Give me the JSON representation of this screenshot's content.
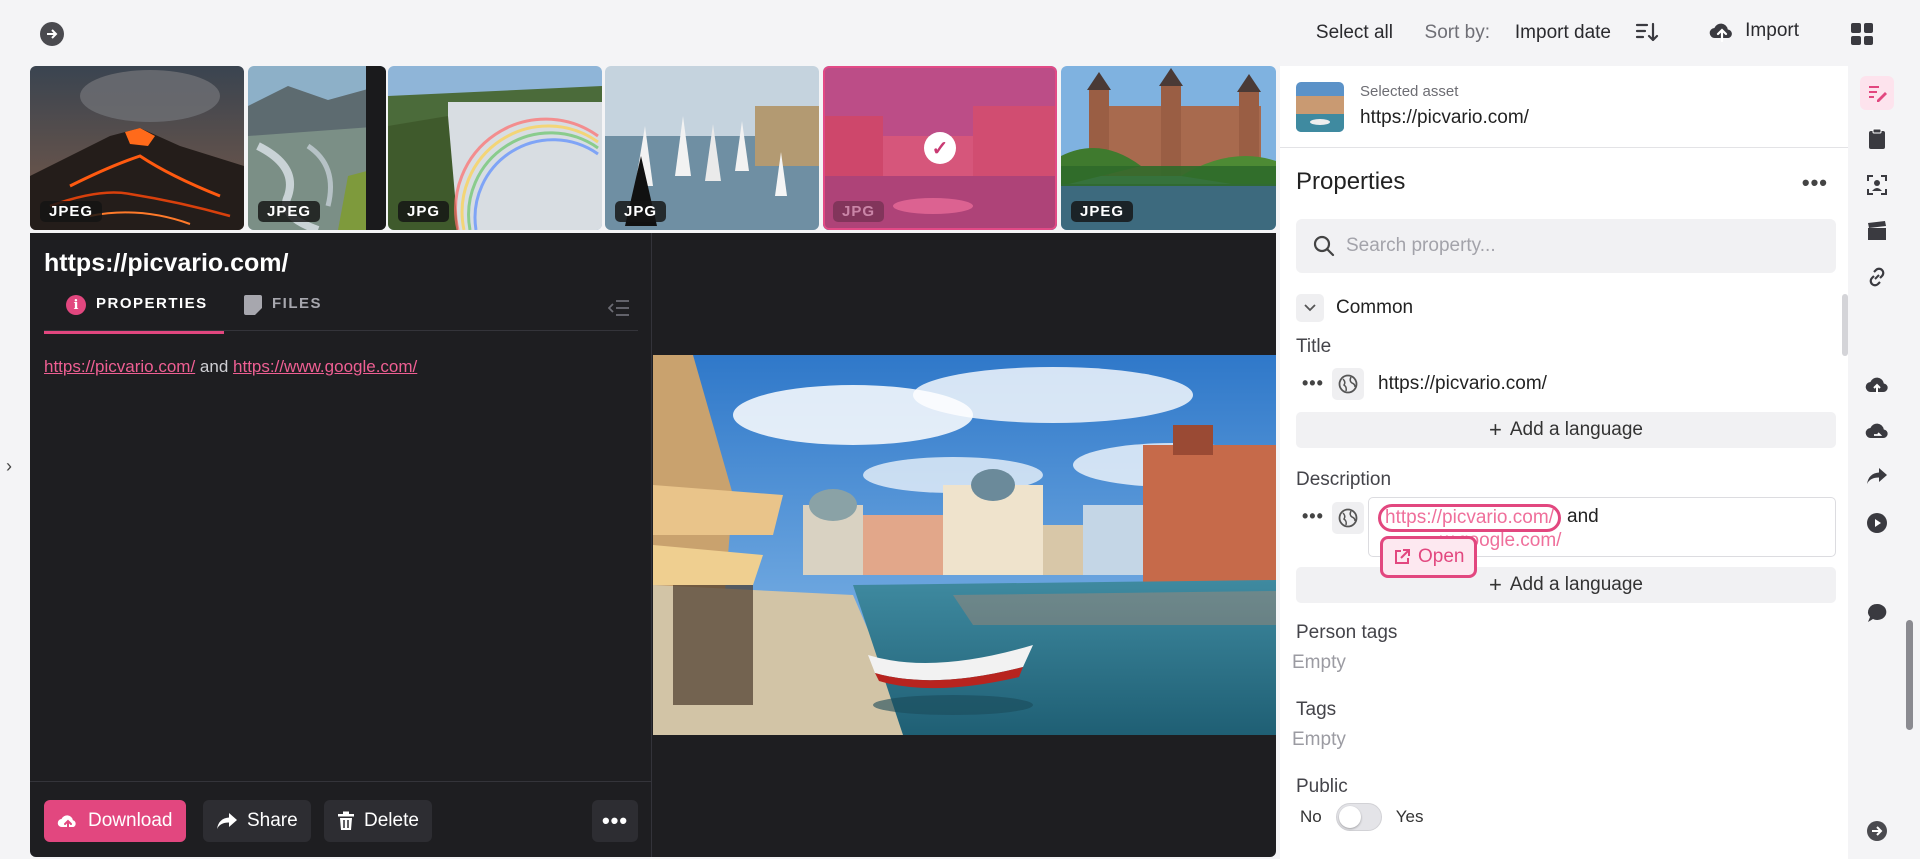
{
  "topbar": {
    "select_all": "Select all",
    "sort_by_label": "Sort by:",
    "sort_value": "Import date",
    "import_label": "Import"
  },
  "thumbnails": [
    {
      "format": "JPEG",
      "subject": "volcano eruption"
    },
    {
      "format": "JPEG",
      "subject": "river valley with hiker"
    },
    {
      "format": "JPG",
      "subject": "waterfall with rainbow"
    },
    {
      "format": "JPG",
      "subject": "sailboats harbour"
    },
    {
      "format": "JPG",
      "subject": "canal city",
      "selected": true
    },
    {
      "format": "JPEG",
      "subject": "castle by river"
    }
  ],
  "viewer": {
    "title": "https://picvario.com/",
    "tabs": {
      "properties": "PROPERTIES",
      "files": "FILES"
    },
    "description": {
      "link1": "https://picvario.com/",
      "connector": "and",
      "link2": "https://www.google.com/"
    },
    "actions": {
      "download": "Download",
      "share": "Share",
      "delete": "Delete",
      "more": "•••"
    }
  },
  "panel": {
    "selected_asset_label": "Selected asset",
    "selected_asset_url": "https://picvario.com/",
    "heading": "Properties",
    "more": "•••",
    "search_placeholder": "Search property...",
    "section": "Common",
    "title_label": "Title",
    "title_value": "https://picvario.com/",
    "add_language": "Add a language",
    "description_label": "Description",
    "description_link1": "https://picvario.com/",
    "description_connector": "and",
    "description_link2_visible": "w.google.com/",
    "open_button": "Open",
    "person_tags_label": "Person tags",
    "person_tags_value": "Empty",
    "tags_label": "Tags",
    "tags_value": "Empty",
    "public_label": "Public",
    "public_no": "No",
    "public_yes": "Yes",
    "public_value": false
  },
  "rail_icons": [
    "edit-properties-icon",
    "clipboard-icon",
    "face-scan-icon",
    "clapper-icon",
    "link-icon",
    "cloud-upload-icon",
    "cloud-sync-icon",
    "share-arrow-icon",
    "play-circle-icon",
    "comment-icon",
    "arrow-right-circle-icon"
  ],
  "colors": {
    "accent": "#e2477f",
    "link": "#ef5f93",
    "viewer_bg": "#1e1e21"
  }
}
